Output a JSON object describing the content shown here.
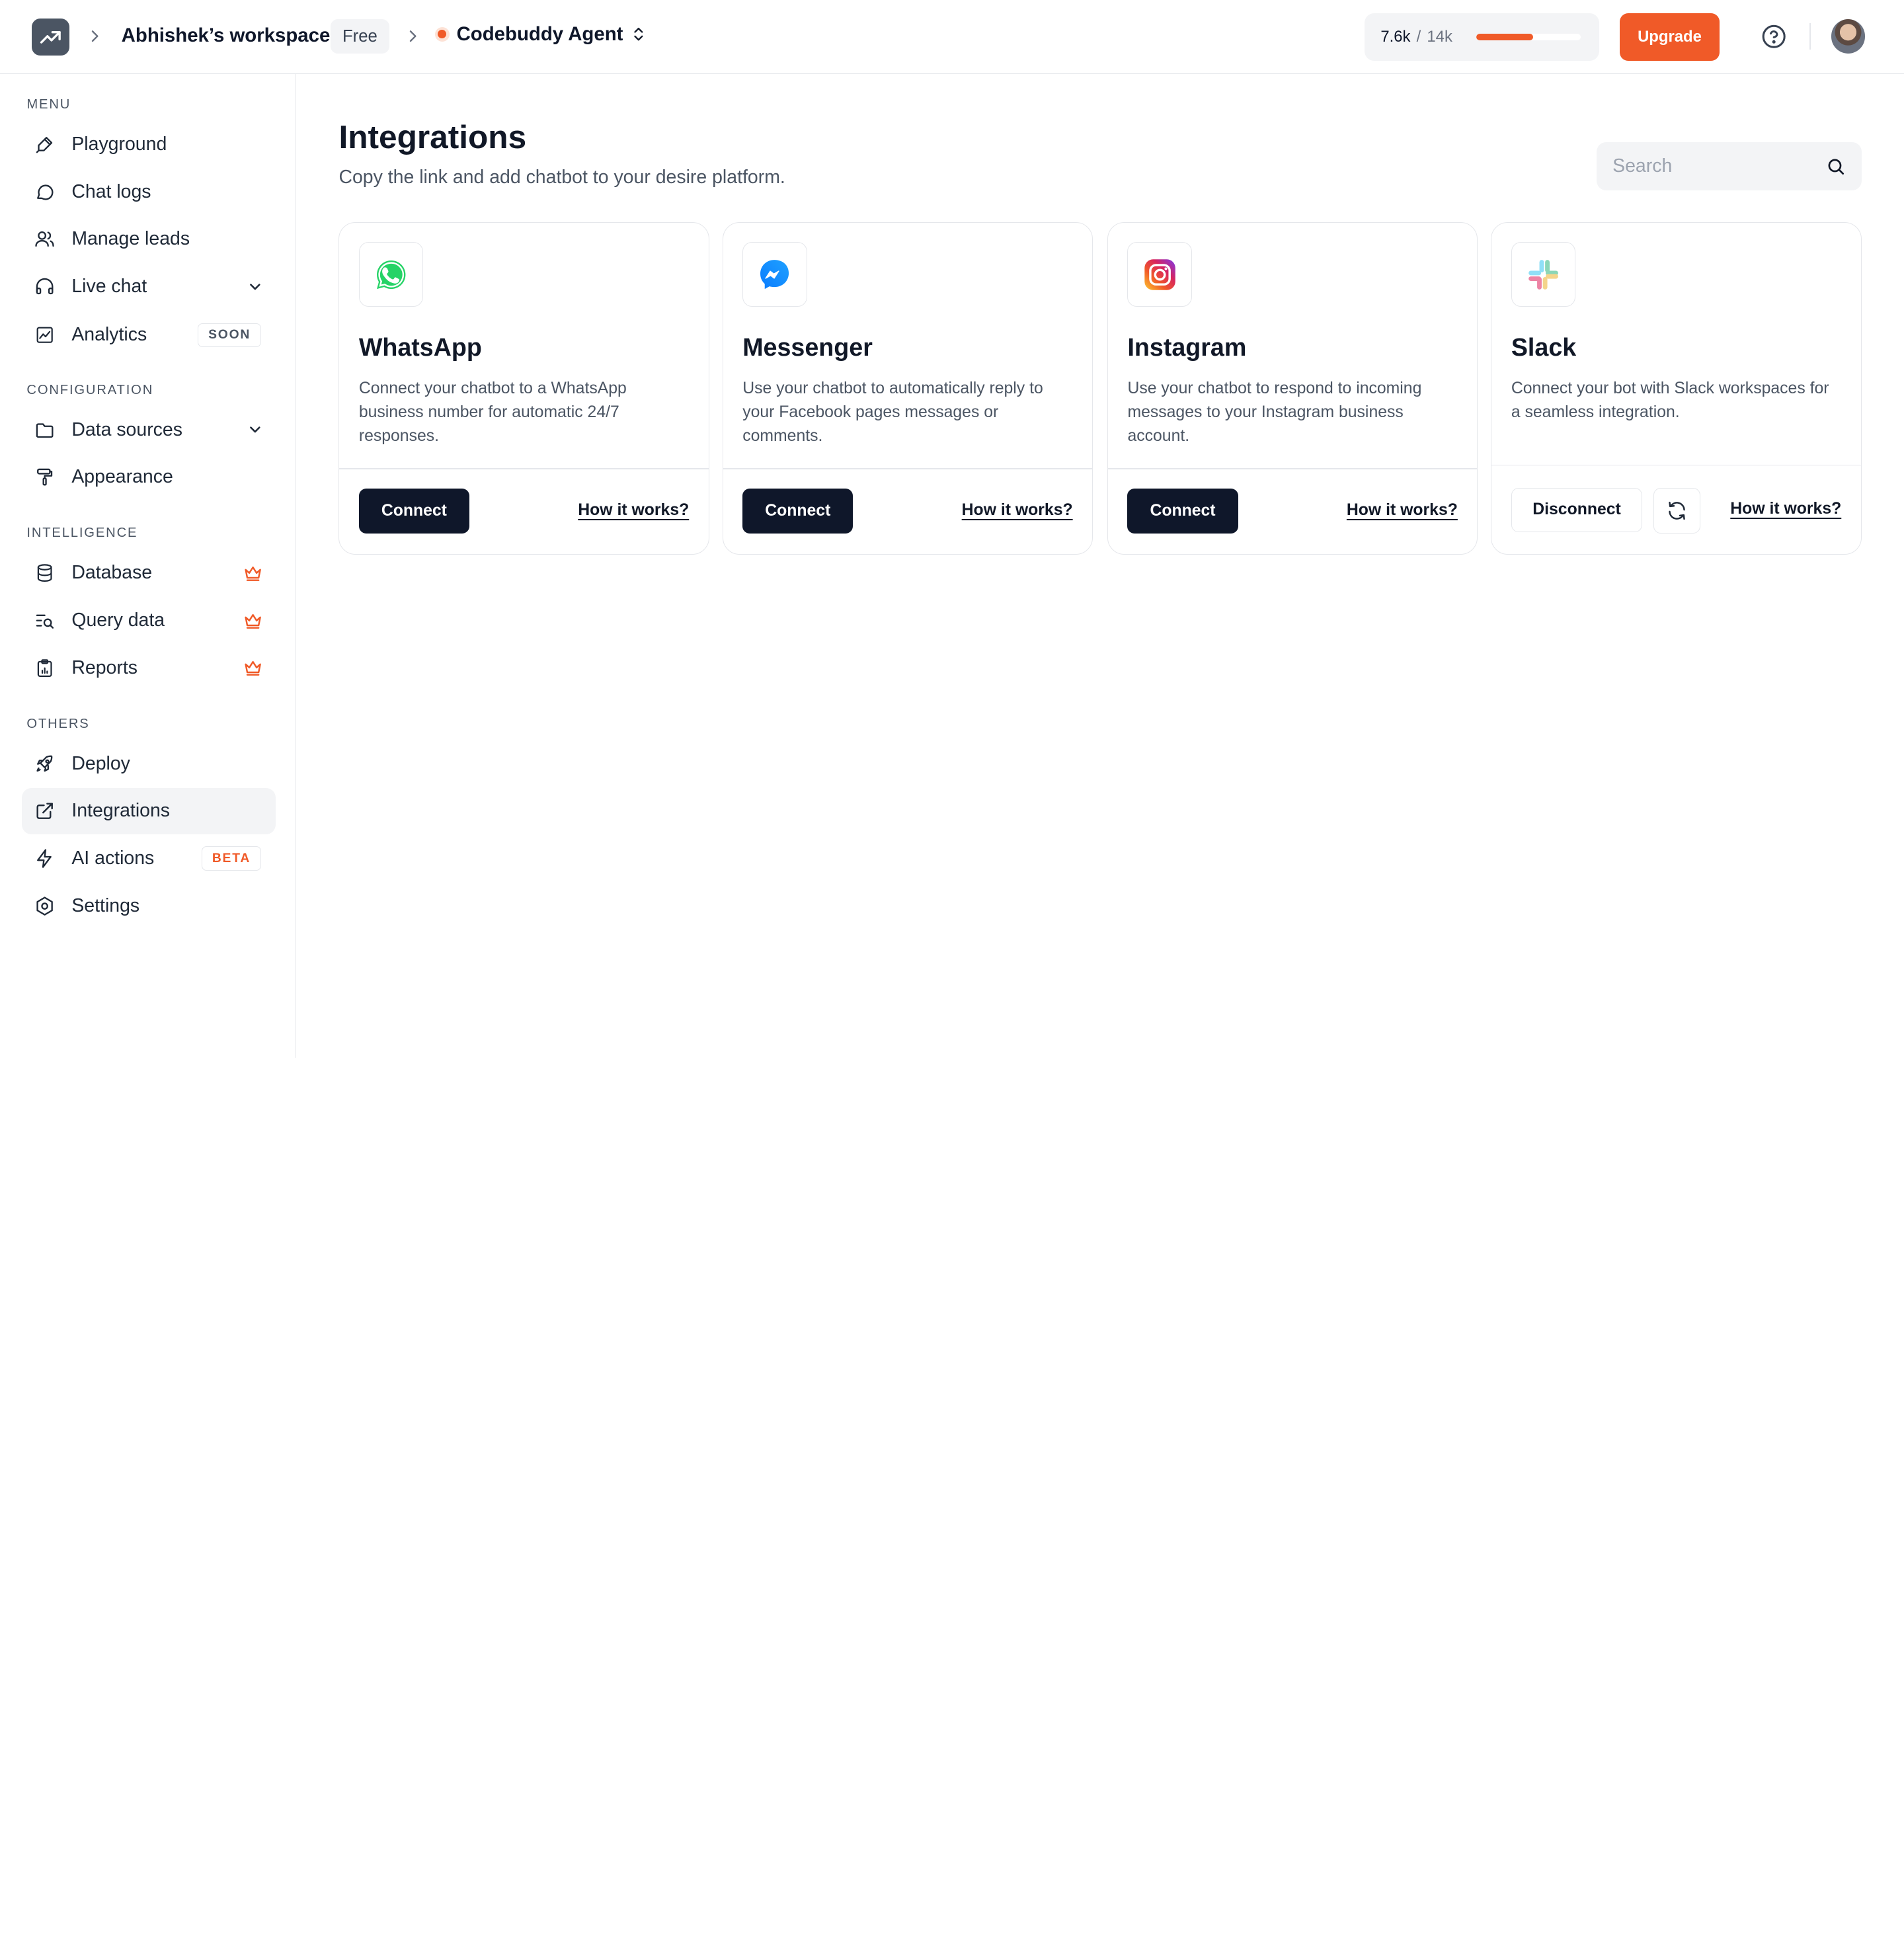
{
  "header": {
    "workspace_name": "Abhishek’s workspace",
    "plan": "Free",
    "agent_name": "Codebuddy Agent",
    "usage_used": "7.6k",
    "usage_separator": "/",
    "usage_total": "14k",
    "usage_fraction": 0.54,
    "upgrade_label": "Upgrade",
    "accent_color": "#f05a28"
  },
  "sidebar": {
    "sections": [
      {
        "title": "MENU"
      },
      {
        "title": "CONFIGURATION"
      },
      {
        "title": "INTELLIGENCE"
      },
      {
        "title": "OTHERS"
      }
    ],
    "items": [
      {
        "label": "Playground",
        "icon": "brush-icon"
      },
      {
        "label": "Chat logs",
        "icon": "chat-bubble-icon"
      },
      {
        "label": "Manage leads",
        "icon": "users-icon"
      },
      {
        "label": "Live chat",
        "icon": "headset-icon",
        "expandable": true
      },
      {
        "label": "Analytics",
        "icon": "chart-icon",
        "tag": "SOON"
      },
      {
        "label": "Data sources",
        "icon": "folder-icon",
        "expandable": true
      },
      {
        "label": "Appearance",
        "icon": "paint-roller-icon"
      },
      {
        "label": "Database",
        "icon": "database-icon",
        "premium": true
      },
      {
        "label": "Query data",
        "icon": "query-icon",
        "premium": true
      },
      {
        "label": "Reports",
        "icon": "report-icon",
        "premium": true
      },
      {
        "label": "Deploy",
        "icon": "rocket-icon"
      },
      {
        "label": "Integrations",
        "icon": "external-link-icon",
        "active": true
      },
      {
        "label": "AI actions",
        "icon": "lightning-icon",
        "tag": "BETA"
      },
      {
        "label": "Settings",
        "icon": "settings-icon"
      }
    ]
  },
  "main": {
    "title": "Integrations",
    "subtitle": "Copy the link and add chatbot to your desire platform.",
    "search_placeholder": "Search",
    "cards": [
      {
        "name": "WhatsApp",
        "description": "Connect your chatbot to a WhatsApp business number for automatic 24/7 responses.",
        "action": "Connect",
        "link": "How it works?"
      },
      {
        "name": "Messenger",
        "description": "Use your chatbot to automatically reply to your Facebook pages messages or comments.",
        "action": "Connect",
        "link": "How it works?"
      },
      {
        "name": "Instagram",
        "description": "Use your chatbot to respond to incoming messages to your Instagram business account.",
        "action": "Connect",
        "link": "How it works?"
      },
      {
        "name": "Slack",
        "description": "Connect your bot with Slack workspaces for a seamless integration.",
        "action": "Disconnect",
        "link": "How it works?"
      }
    ]
  }
}
